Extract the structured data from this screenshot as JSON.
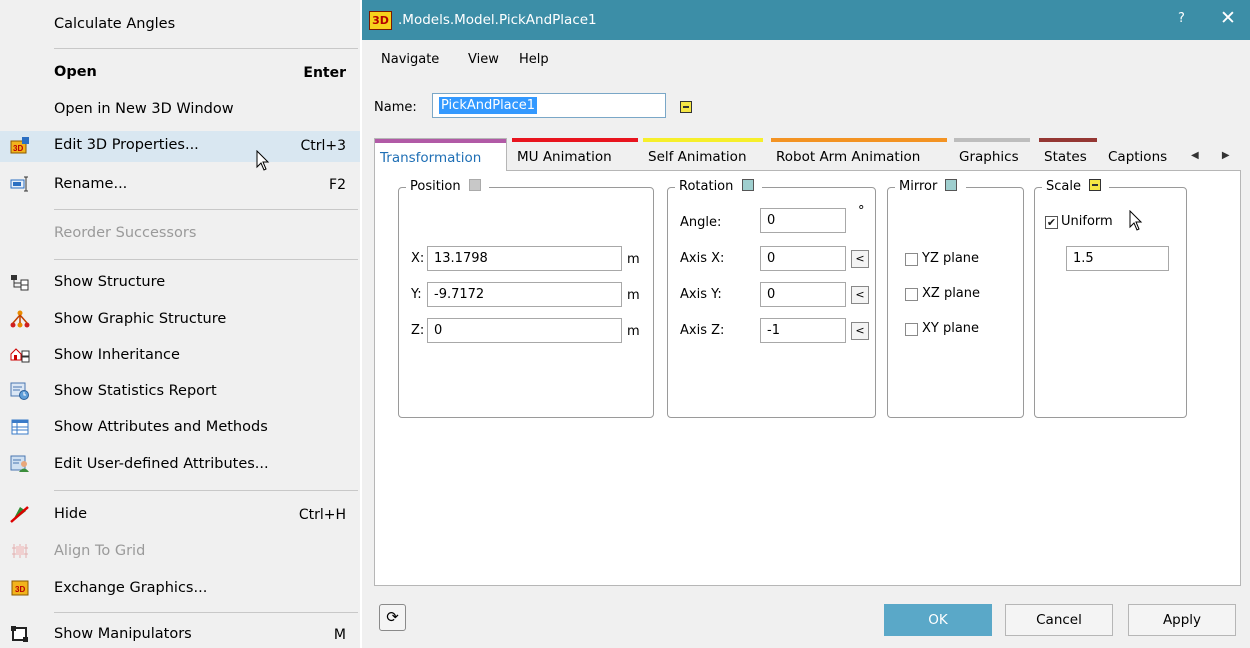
{
  "context_menu": {
    "items": [
      {
        "label": "Calculate Angles",
        "shortcut": "",
        "icon": ""
      },
      {
        "label": "Open",
        "shortcut": "Enter",
        "icon": ""
      },
      {
        "label": "Open in New 3D Window",
        "shortcut": "",
        "icon": ""
      },
      {
        "label": "Edit 3D Properties...",
        "shortcut": "Ctrl+3",
        "icon": "3d-properties-icon"
      },
      {
        "label": "Rename...",
        "shortcut": "F2",
        "icon": "rename-icon"
      },
      {
        "label": "Reorder Successors",
        "shortcut": "",
        "icon": ""
      },
      {
        "label": "Show Structure",
        "shortcut": "",
        "icon": "structure-icon"
      },
      {
        "label": "Show Graphic Structure",
        "shortcut": "",
        "icon": "graphic-structure-icon"
      },
      {
        "label": "Show Inheritance",
        "shortcut": "",
        "icon": "inheritance-icon"
      },
      {
        "label": "Show Statistics Report",
        "shortcut": "",
        "icon": "statistics-report-icon"
      },
      {
        "label": "Show Attributes and Methods",
        "shortcut": "",
        "icon": "attributes-table-icon"
      },
      {
        "label": "Edit User-defined Attributes...",
        "shortcut": "",
        "icon": "user-attributes-icon"
      },
      {
        "label": "Hide",
        "shortcut": "Ctrl+H",
        "icon": "hide-icon"
      },
      {
        "label": "Align To Grid",
        "shortcut": "",
        "icon": "align-grid-icon"
      },
      {
        "label": "Exchange Graphics...",
        "shortcut": "",
        "icon": "exchange-graphics-icon"
      },
      {
        "label": "Show Manipulators",
        "shortcut": "M",
        "icon": "manipulators-icon"
      }
    ]
  },
  "dialog": {
    "logo_text": "3D",
    "title": ".Models.Model.PickAndPlace1",
    "help_label": "?",
    "close_label": "✕",
    "menu": [
      "Navigate",
      "View",
      "Help"
    ],
    "name_label": "Name:",
    "name_value": "PickAndPlace1",
    "tabs": [
      {
        "label": "Transformation",
        "color": "#b15aa6"
      },
      {
        "label": "MU Animation",
        "color": "#e8141e"
      },
      {
        "label": "Self Animation",
        "color": "#f6ef2b"
      },
      {
        "label": "Robot Arm Animation",
        "color": "#f39323"
      },
      {
        "label": "Graphics",
        "color": "#bdbdbd"
      },
      {
        "label": "States",
        "color": "#953733"
      },
      {
        "label": "Captions",
        "color": ""
      }
    ],
    "tab_arrows": "◀ ▶",
    "position": {
      "title": "Position",
      "x_label": "X:",
      "x_value": "13.1798",
      "y_label": "Y:",
      "y_value": "-9.7172",
      "z_label": "Z:",
      "z_value": "0",
      "unit": "m"
    },
    "rotation": {
      "title": "Rotation",
      "angle_label": "Angle:",
      "angle_value": "0",
      "angle_unit": "°",
      "axis_x_label": "Axis X:",
      "axis_x_value": "0",
      "axis_y_label": "Axis Y:",
      "axis_y_value": "0",
      "axis_z_label": "Axis Z:",
      "axis_z_value": "-1",
      "pick_symbol": "<"
    },
    "mirror": {
      "title": "Mirror",
      "options": [
        {
          "label": "YZ plane",
          "checked": false
        },
        {
          "label": "XZ plane",
          "checked": false
        },
        {
          "label": "XY plane",
          "checked": false
        }
      ]
    },
    "scale": {
      "title": "Scale",
      "uniform_label": "Uniform",
      "uniform_checked": true,
      "value": "1.5"
    },
    "refresh_symbol": "⟳",
    "buttons": {
      "ok": "OK",
      "cancel": "Cancel",
      "apply": "Apply"
    }
  }
}
